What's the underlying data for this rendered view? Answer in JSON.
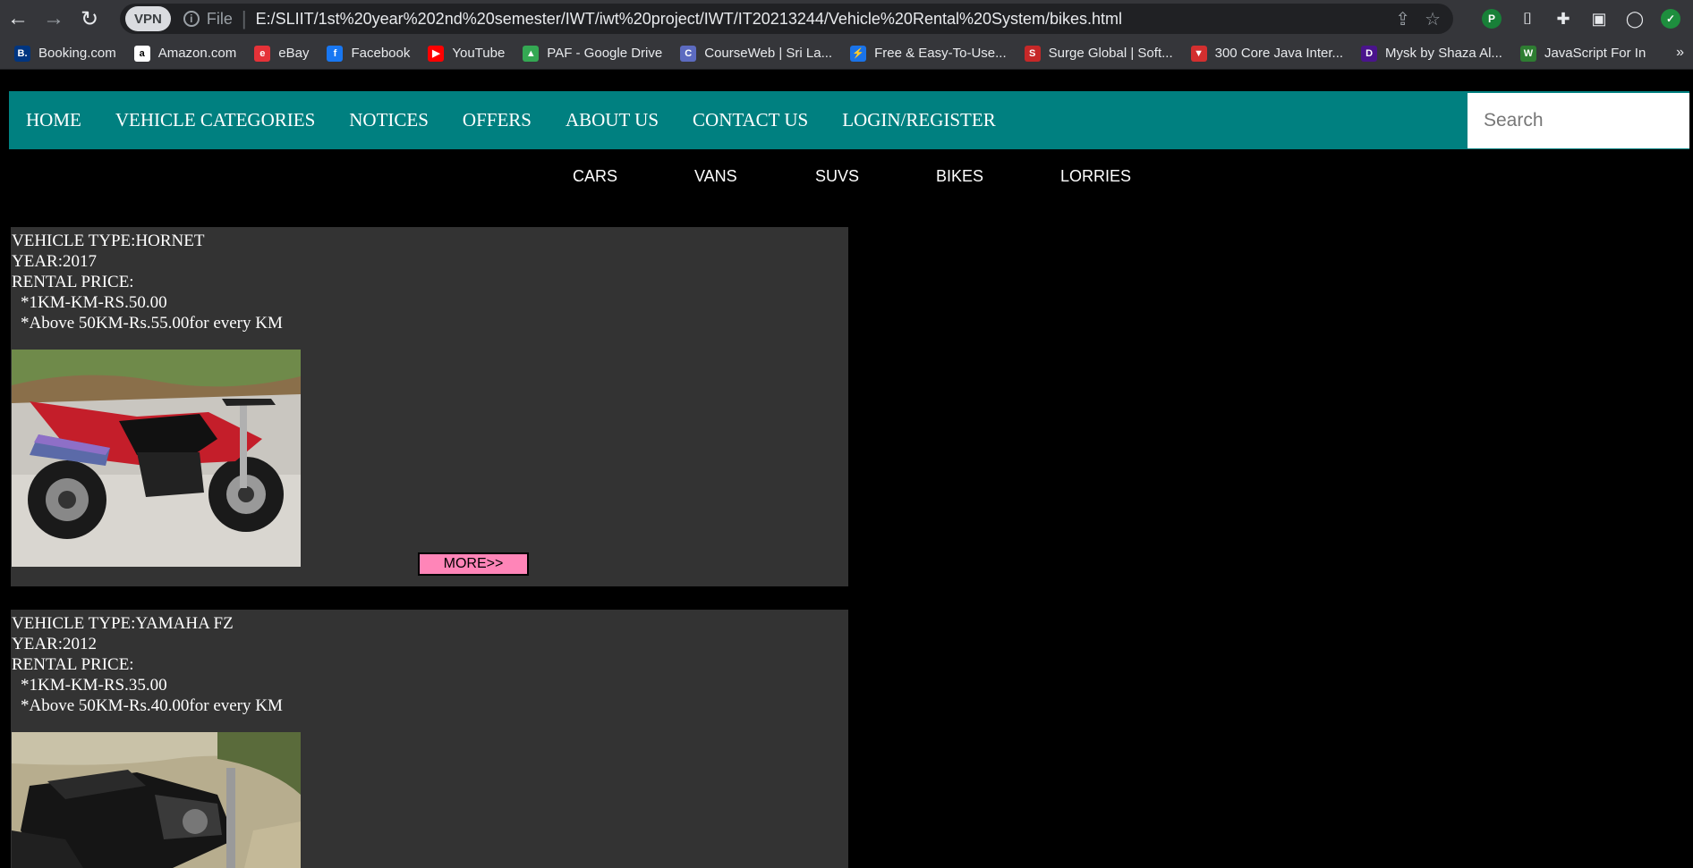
{
  "browser": {
    "vpn_label": "VPN",
    "file_label": "File",
    "url": "E:/SLIIT/1st%20year%202nd%20semester/IWT/iwt%20project/IWT/IT20213244/Vehicle%20Rental%20System/bikes.html",
    "bookmarks": [
      {
        "label": "Booking.com",
        "icon": "booking-icon",
        "color": "#003580",
        "glyph": "B."
      },
      {
        "label": "Amazon.com",
        "icon": "amazon-icon",
        "color": "#ffffff",
        "glyph": "a"
      },
      {
        "label": "eBay",
        "icon": "ebay-icon",
        "color": "#e53238",
        "glyph": "e"
      },
      {
        "label": "Facebook",
        "icon": "facebook-icon",
        "color": "#1877f2",
        "glyph": "f"
      },
      {
        "label": "YouTube",
        "icon": "youtube-icon",
        "color": "#ff0000",
        "glyph": "▶"
      },
      {
        "label": "PAF - Google Drive",
        "icon": "google-drive-icon",
        "color": "#34a853",
        "glyph": "▲"
      },
      {
        "label": "CourseWeb | Sri La...",
        "icon": "courseweb-icon",
        "color": "#5c6bc0",
        "glyph": "C"
      },
      {
        "label": "Free & Easy-To-Use...",
        "icon": "free-tool-icon",
        "color": "#1a73e8",
        "glyph": "⚡"
      },
      {
        "label": "Surge Global | Soft...",
        "icon": "surge-global-icon",
        "color": "#c62828",
        "glyph": "S"
      },
      {
        "label": "300 Core Java Inter...",
        "icon": "java-icon",
        "color": "#d32f2f",
        "glyph": "▼"
      },
      {
        "label": "Mysk by Shaza Al...",
        "icon": "mysk-icon",
        "color": "#4a148c",
        "glyph": "D"
      },
      {
        "label": "JavaScript For In",
        "icon": "javascript-icon",
        "color": "#2e7d32",
        "glyph": "W"
      }
    ],
    "more_label": "»"
  },
  "nav": {
    "items": [
      "HOME",
      "VEHICLE CATEGORIES",
      "NOTICES",
      "OFFERS",
      "ABOUT US",
      "CONTACT US",
      "LOGIN/REGISTER"
    ],
    "search_placeholder": "Search"
  },
  "subnav": {
    "items": [
      "CARS",
      "VANS",
      "SUVS",
      "BIKES",
      "LORRIES"
    ]
  },
  "vehicles": [
    {
      "type_line": "VEHICLE TYPE:HORNET",
      "year_line": "YEAR:2017",
      "price_label": "RENTAL PRICE:",
      "price_1": "*1KM-KM-RS.50.00",
      "price_2": "*Above 50KM-Rs.55.00for every KM",
      "image_label": "red-motorcycle-photo",
      "more_label": "MORE>>"
    },
    {
      "type_line": "VEHICLE TYPE:YAMAHA FZ",
      "year_line": "YEAR:2012",
      "price_label": "RENTAL PRICE:",
      "price_1": "*1KM-KM-RS.35.00",
      "price_2": "*Above 50KM-Rs.40.00for every KM",
      "image_label": "black-motorcycle-photo"
    }
  ],
  "colors": {
    "nav_bg": "#008080",
    "card_bg": "#333333",
    "more_btn": "#ff85b8"
  }
}
